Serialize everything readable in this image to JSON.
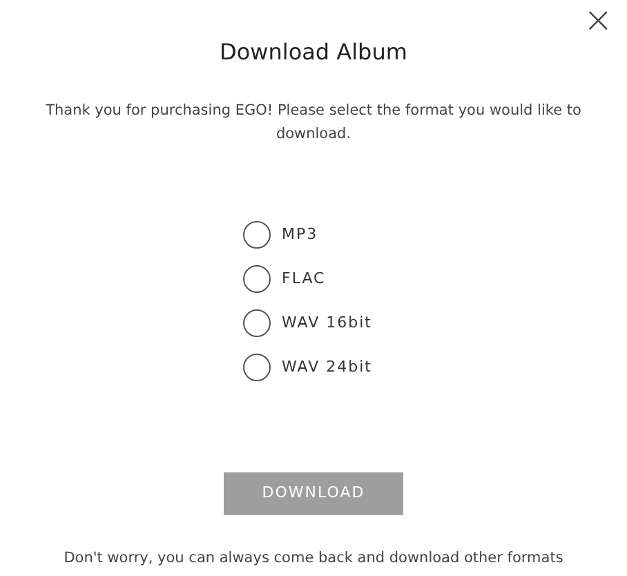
{
  "dialog": {
    "title": "Download Album",
    "close": "×",
    "message": "Thank you for purchasing EGO! Please select the format you would like to download.",
    "formats": [
      {
        "label": "MP3",
        "selected": false
      },
      {
        "label": "FLAC",
        "selected": false
      },
      {
        "label": "WAV 16bit",
        "selected": false
      },
      {
        "label": "WAV 24bit",
        "selected": false
      }
    ],
    "button": {
      "label": "DOWNLOAD",
      "disabled": true
    },
    "footer": "Don't worry, you can always come back and download other formats"
  }
}
